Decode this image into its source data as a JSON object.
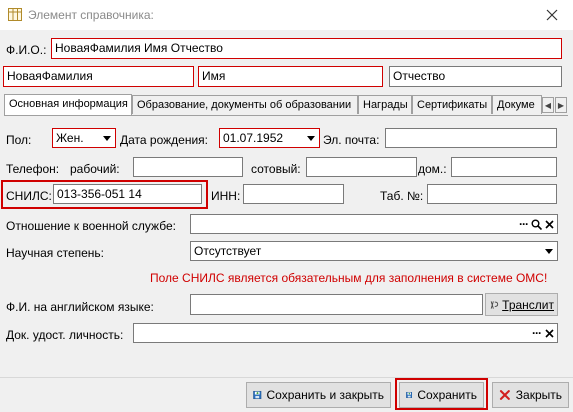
{
  "window": {
    "title": "Элемент справочника:"
  },
  "fio": {
    "label": "Ф.И.О.:",
    "full": "НоваяФамилия Имя Отчество",
    "last": "НоваяФамилия",
    "first": "Имя",
    "middle": "Отчество"
  },
  "tabs": [
    {
      "label": "Основная информация"
    },
    {
      "label": "Образование, документы об образовании"
    },
    {
      "label": "Награды"
    },
    {
      "label": "Сертификаты"
    },
    {
      "label": "Докуме"
    }
  ],
  "form": {
    "gender_label": "Пол:",
    "gender_value": "Жен.",
    "birth_label": "Дата рождения:",
    "birth_value": "01.07.1952",
    "email_label": "Эл. почта:",
    "email_value": "",
    "phone_label": "Телефон:",
    "work_label": "рабочий:",
    "work_value": "",
    "mobile_label": "сотовый:",
    "mobile_value": "",
    "home_label": "дом.:",
    "home_value": "",
    "snils_label": "СНИЛС:",
    "snils_value": "013-356-051 14",
    "inn_label": "ИНН:",
    "inn_value": "",
    "tab_label": "Таб. №:",
    "tab_value": "",
    "military_label": "Отношение к военной службе:",
    "military_value": "",
    "degree_label": "Научная степень:",
    "degree_value": "Отсутствует",
    "error_text": "Поле СНИЛС является обязательным для заполнения в системе ОМС!",
    "english_label": "Ф.И. на английском языке:",
    "english_value": "",
    "translit_label": "Транслит",
    "id_doc_label": "Док. удост. личность:",
    "id_doc_value": ""
  },
  "footer": {
    "save_close_label": "Сохранить и закрыть",
    "save_label": "Сохранить",
    "close_label": "Закрыть"
  },
  "colors": {
    "required": "#d00000",
    "highlight": "#d00000",
    "close_x": "#d21f1f",
    "save_icon": "#2a6ebb"
  },
  "icons": [
    "table-icon",
    "close-icon",
    "chevron-down-icon",
    "more-icon",
    "search-icon",
    "clear-icon",
    "translit-icon",
    "save-icon",
    "close-x-icon"
  ]
}
